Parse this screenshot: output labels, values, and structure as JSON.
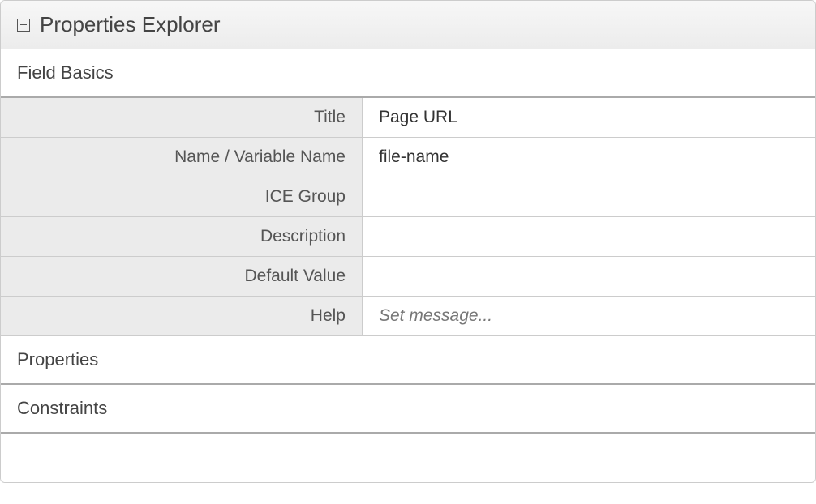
{
  "panel": {
    "title": "Properties Explorer"
  },
  "sections": {
    "field_basics": {
      "header": "Field Basics",
      "rows": {
        "title": {
          "label": "Title",
          "value": "Page URL"
        },
        "name": {
          "label": "Name / Variable Name",
          "value": "file-name"
        },
        "ice_group": {
          "label": "ICE Group",
          "value": ""
        },
        "description": {
          "label": "Description",
          "value": ""
        },
        "default_value": {
          "label": "Default Value",
          "value": ""
        },
        "help": {
          "label": "Help",
          "placeholder": "Set message..."
        }
      }
    },
    "properties": {
      "header": "Properties"
    },
    "constraints": {
      "header": "Constraints"
    }
  }
}
